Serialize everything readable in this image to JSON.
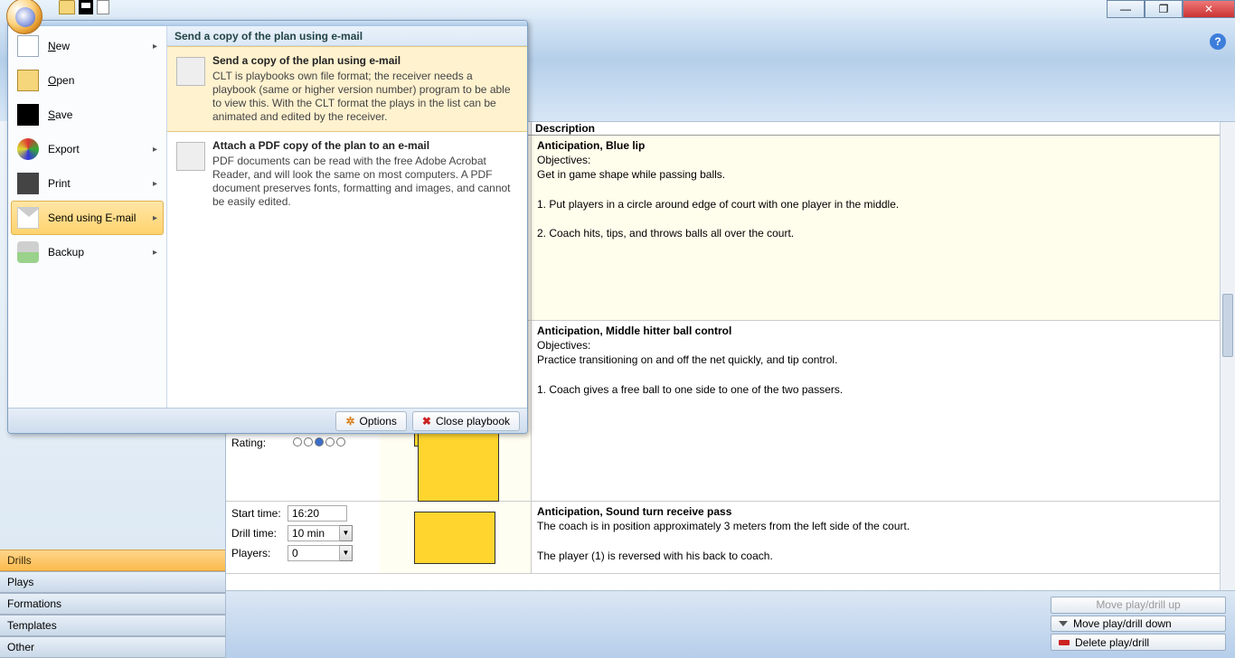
{
  "window": {
    "minimize": "—",
    "maximize": "❐",
    "close": "✕"
  },
  "help": "?",
  "appmenu": {
    "items": [
      {
        "label": "New",
        "u": "N",
        "arrow": true,
        "ic": "ic-new"
      },
      {
        "label": "Open",
        "u": "O",
        "arrow": false,
        "ic": "ic-open"
      },
      {
        "label": "Save",
        "u": "S",
        "arrow": false,
        "ic": "ic-save"
      },
      {
        "label": "Export",
        "u": "",
        "arrow": true,
        "ic": "ic-export"
      },
      {
        "label": "Print",
        "u": "",
        "arrow": true,
        "ic": "ic-print"
      },
      {
        "label": "Send using E-mail",
        "u": "",
        "arrow": true,
        "ic": "ic-email",
        "sel": true
      },
      {
        "label": "Backup",
        "u": "",
        "arrow": true,
        "ic": "ic-backup"
      }
    ],
    "right_header": "Send a copy of the plan using e-mail",
    "sub": [
      {
        "title": "Send a copy of the plan using e-mail",
        "desc": "CLT is playbooks own file format; the receiver needs a playbook (same or higher version number) program to be able to view this.  With the CLT format the plays in the list can be animated and edited by the receiver.",
        "sel": true
      },
      {
        "title": "Attach a PDF copy of the plan to an e-mail",
        "desc": "PDF documents can be read with the free Adobe Acrobat Reader, and will look the same on most computers. A PDF document preserves fonts, formatting and images, and cannot be easily edited.",
        "sel": false
      }
    ],
    "footer": {
      "options": "Options",
      "close": "Close playbook"
    }
  },
  "nav": [
    "Drills",
    "Plays",
    "Formations",
    "Templates",
    "Other"
  ],
  "nav_sel": 0,
  "grid": {
    "header": "Description",
    "rows": [
      {
        "title": "Anticipation, Blue lip",
        "body": "Objectives:\nGet in game shape while passing balls.\n\n1. Put players in a circle around edge of court with one player in the middle.\n\n2. Coach hits, tips, and throws balls all over the court.",
        "sel": true
      },
      {
        "title": "Anticipation, Middle hitter ball control",
        "body": "Objectives:\nPractice transitioning on and off the net quickly, and tip control.\n\n1. Coach gives a free ball to one side to one of the two passers."
      },
      {
        "title": "Anticipation, Sound turn receive pass",
        "body": "The coach is in position approximately 3 meters from the left side of the court.\n\nThe player (1) is reversed with his back to coach."
      }
    ],
    "row2meta": {
      "start_lbl": "Start time:",
      "start": "16:20",
      "drill_lbl": "Drill time:",
      "drill": "10 min",
      "players_lbl": "Players:",
      "players": "0"
    }
  },
  "peek": {
    "rating_lbl": "Rating:"
  },
  "footer": {
    "up": "Move play/drill up",
    "down": "Move play/drill down",
    "del": "Delete play/drill"
  }
}
